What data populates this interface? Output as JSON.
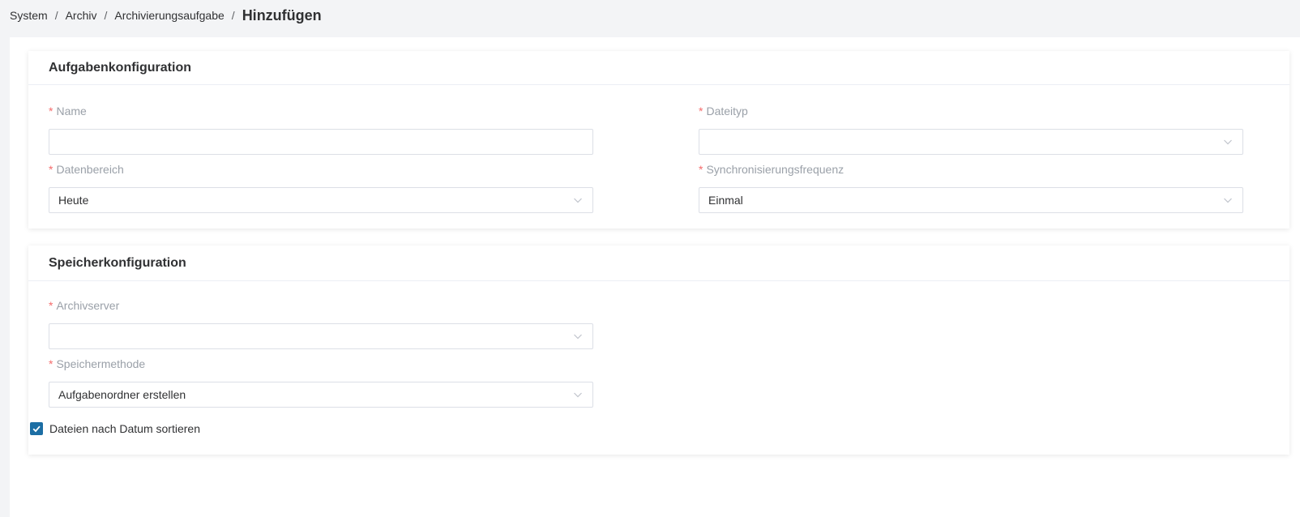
{
  "breadcrumb": {
    "items": [
      "System",
      "Archiv",
      "Archivierungsaufgabe"
    ],
    "separator": "/",
    "current": "Hinzufügen"
  },
  "task_config": {
    "title": "Aufgabenkonfiguration",
    "name": {
      "label": "Name",
      "value": "",
      "required_mark": "*"
    },
    "file_type": {
      "label": "Dateityp",
      "value": "",
      "required_mark": "*"
    },
    "data_range": {
      "label": "Datenbereich",
      "value": "Heute",
      "required_mark": "*"
    },
    "sync_frequency": {
      "label": "Synchronisierungsfrequenz",
      "value": "Einmal",
      "required_mark": "*"
    }
  },
  "storage_config": {
    "title": "Speicherkonfiguration",
    "archive_server": {
      "label": "Archivserver",
      "value": "",
      "required_mark": "*"
    },
    "storage_method": {
      "label": "Speichermethode",
      "value": "Aufgabenordner erstellen",
      "required_mark": "*"
    },
    "sort_by_date": {
      "label": "Dateien nach Datum sortieren",
      "checked": true
    }
  },
  "colors": {
    "required": "#f56c6c",
    "checkbox": "#1c6ea4",
    "label": "#9aa0a8",
    "border": "#dcdfe6"
  },
  "icons": {
    "select_arrow": "chevron-down-icon",
    "checkbox": "check-icon"
  }
}
